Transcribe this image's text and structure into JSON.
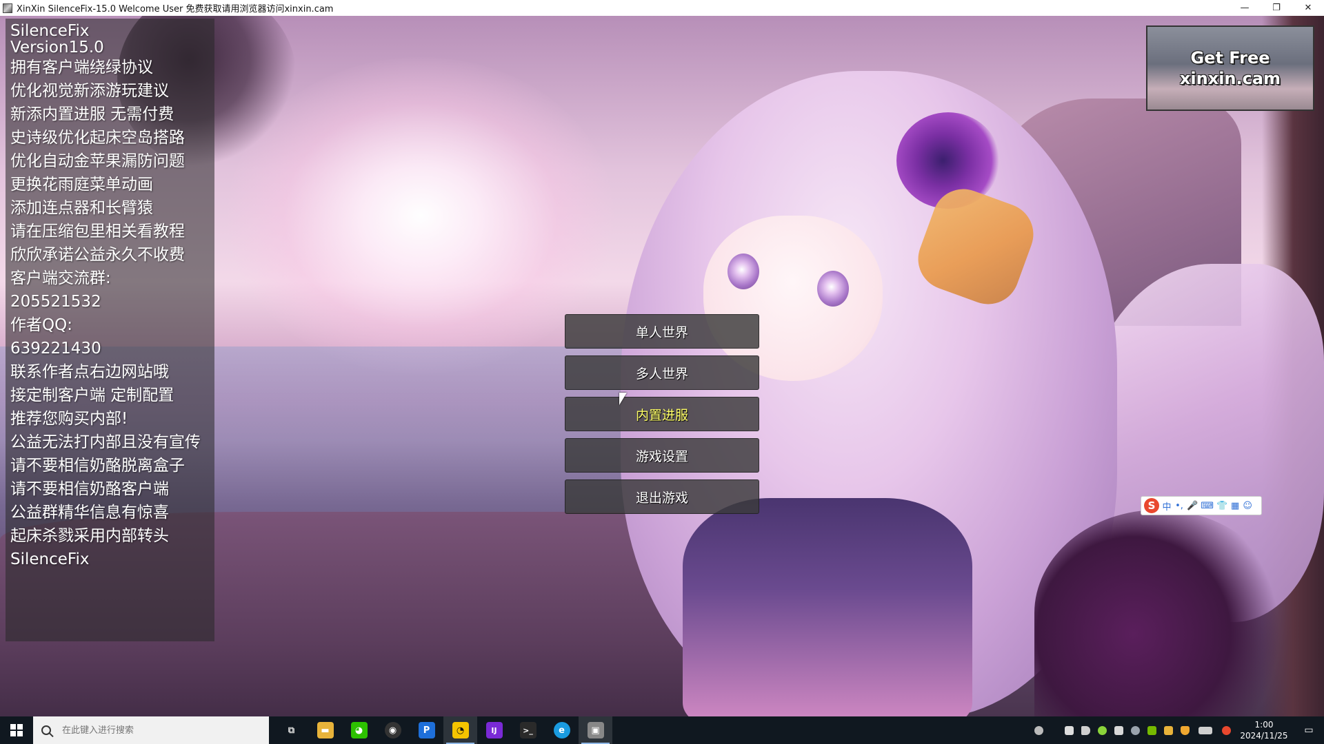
{
  "window": {
    "title": "XinXin SilenceFix-15.0 Welcome User 免费获取请用浏览器访问xinxin.cam",
    "minimize_glyph": "—",
    "restore_glyph": "❐",
    "close_glyph": "✕"
  },
  "info_panel": {
    "lines": [
      "SilenceFix",
      "Version15.0",
      "拥有客户端绕绿协议",
      "优化视觉新添游玩建议",
      "新添内置进服 无需付费",
      "史诗级优化起床空岛搭路",
      "优化自动金苹果漏防问题",
      "更换花雨庭菜单动画",
      "添加连点器和长臂猿",
      "请在压缩包里相关看教程",
      "欣欣承诺公益永久不收费",
      "客户端交流群:",
      "205521532",
      "作者QQ:",
      "639221430",
      "联系作者点右边网站哦",
      "接定制客户端 定制配置",
      "推荐您购买内部!",
      "公益无法打内部且没有宣传",
      "请不要相信奶酪脱离盒子",
      "请不要相信奶酪客户端",
      "公益群精华信息有惊喜",
      "起床杀戮采用内部转头",
      "SilenceFix"
    ]
  },
  "ad": {
    "line1": "Get Free",
    "line2": "xinxin.cam"
  },
  "menu": {
    "singleplayer": "单人世界",
    "multiplayer": "多人世界",
    "builtin_server": "内置进服",
    "settings": "游戏设置",
    "quit": "退出游戏"
  },
  "ime": {
    "logo": "S",
    "items": [
      "中",
      "•,",
      "🎤",
      "⌨",
      "👕",
      "▦",
      "☺"
    ]
  },
  "taskbar": {
    "search_placeholder": "在此键入进行搜索",
    "apps": [
      {
        "name": "task-view-icon",
        "glyph": "⧉",
        "color": "#101820"
      },
      {
        "name": "file-explorer-icon",
        "glyph": "▬",
        "color": "#e8b33a"
      },
      {
        "name": "wechat-icon",
        "glyph": "◕",
        "color": "#2dc100"
      },
      {
        "name": "obs-icon",
        "glyph": "◉",
        "color": "#333333"
      },
      {
        "name": "p-app-icon",
        "glyph": "P",
        "color": "#1e6fd9"
      },
      {
        "name": "qq-icon",
        "glyph": "◔",
        "color": "#f5c400"
      },
      {
        "name": "jetbrains-icon",
        "glyph": "IJ",
        "color": "#7a2ad6"
      },
      {
        "name": "terminal-icon",
        "glyph": ">_",
        "color": "#2a2a2a"
      },
      {
        "name": "edge-icon",
        "glyph": "e",
        "color": "#1a9be0"
      },
      {
        "name": "minecraft-app-icon",
        "glyph": "▣",
        "color": "#888888"
      }
    ],
    "time": "1:00",
    "date": "2024/11/25",
    "notification_glyph": "▭"
  }
}
